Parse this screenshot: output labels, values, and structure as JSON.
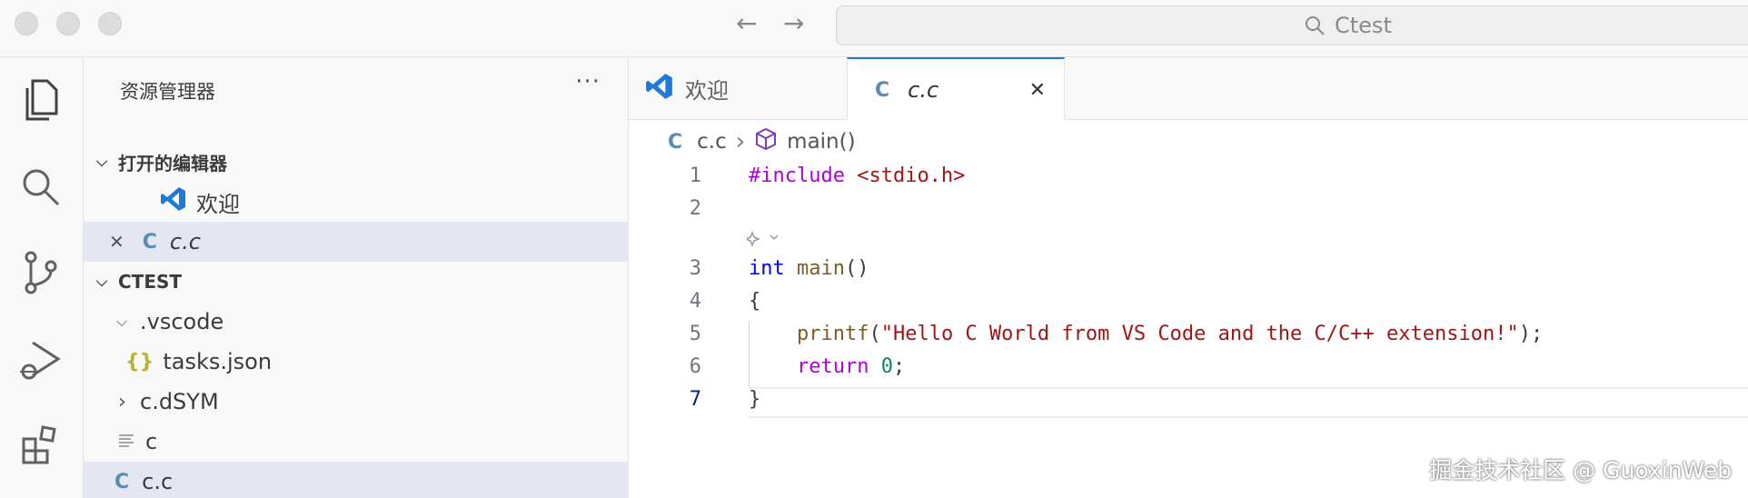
{
  "titlebar": {
    "search_text": "Ctest",
    "back_icon": "arrow-left-icon",
    "forward_icon": "arrow-right-icon"
  },
  "activity_bar": {
    "items": [
      "explorer-icon",
      "search-icon",
      "source-control-icon",
      "run-debug-icon",
      "extensions-icon"
    ]
  },
  "sidebar": {
    "header": "资源管理器",
    "more": "···",
    "open_editors": {
      "title": "打开的编辑器",
      "items": [
        {
          "label": "欢迎",
          "icon": "vscode-icon"
        },
        {
          "label": "c.c",
          "icon": "c-file-icon",
          "icon_text": "C",
          "close": "✕"
        }
      ]
    },
    "project": {
      "title": "CTEST",
      "items": [
        {
          "label": ".vscode",
          "chevron": "⌵"
        },
        {
          "label": "tasks.json",
          "icon_text": "{}"
        },
        {
          "label": "c.dSYM",
          "chevron": "›"
        },
        {
          "label": "c"
        },
        {
          "label": "c.c",
          "icon_text": "C"
        }
      ]
    }
  },
  "tabs": [
    {
      "label": "欢迎",
      "icon": "vscode-icon"
    },
    {
      "label": "c.c",
      "icon_text": "C",
      "close": "✕"
    }
  ],
  "breadcrumb": {
    "file_icon_text": "C",
    "file": "c.c",
    "separator": "›",
    "symbol": "main()"
  },
  "editor": {
    "lines": [
      {
        "num": "1"
      },
      {
        "num": "2"
      },
      {
        "num": "3"
      },
      {
        "num": "4"
      },
      {
        "num": "5"
      },
      {
        "num": "6"
      },
      {
        "num": "7"
      }
    ],
    "code": {
      "l1_directive": "#include",
      "l1_header": " <stdio.h>",
      "l3_type": "int",
      "l3_fn": " main",
      "l3_rest": "()",
      "l4": "{",
      "l5_indent": "    ",
      "l5_fn": "printf",
      "l5_open": "(",
      "l5_str": "\"Hello C World from VS Code and the C/C++ extension!\"",
      "l5_close": ");",
      "l6_indent": "    ",
      "l6_kw": "return",
      "l6_num": " 0",
      "l6_end": ";",
      "l7": "}"
    }
  },
  "watermark": "掘金技术社区 @ GuoxinWeb"
}
